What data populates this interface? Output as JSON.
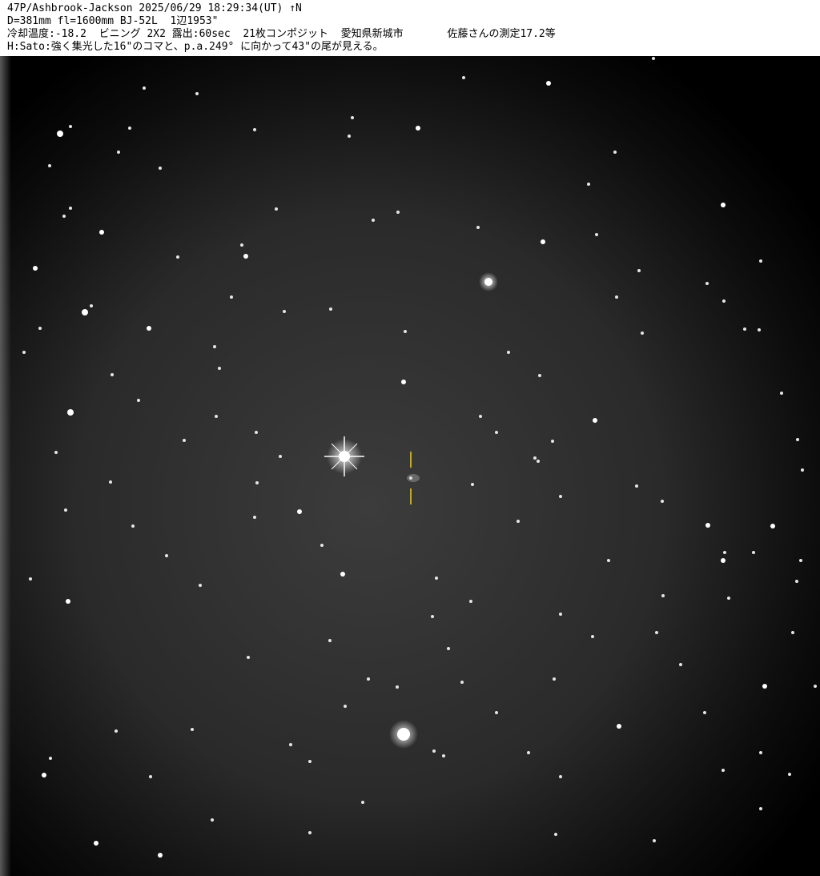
{
  "caption": {
    "line1": "47P/Ashbrook-Jackson 2025/06/29 18:29:34(UT) ↑N",
    "line2": "D=381mm fl=1600mm BJ-52L  1辺1953\"",
    "line3": "冷却温度:-18.2  ビニング 2X2 露出:60sec  21枚コンポジット  愛知県新城市       佐藤さんの測定17.2等",
    "line4": "H:Sato:強く集光した16\"のコマと、p.a.249° に向かって43\"の尾が見える。"
  },
  "image": {
    "subject": "comet-star-field",
    "marker_color": "#f2d400"
  }
}
